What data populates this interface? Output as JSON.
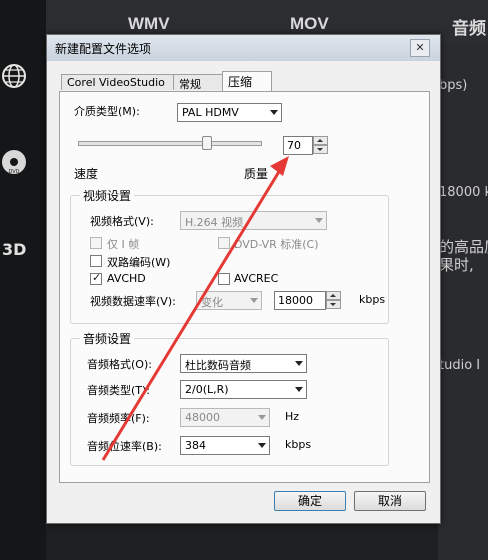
{
  "background": {
    "tabs": [
      "WMV",
      "MOV",
      "音频"
    ],
    "right_texts": [
      "bps)",
      "18000 k",
      "的高品质",
      "果时,",
      "tudio I"
    ]
  },
  "dialog": {
    "title": "新建配置文件选项",
    "close_symbol": "✕",
    "tabs": [
      "Corel VideoStudio",
      "常规",
      "压缩"
    ],
    "active_tab": "压缩",
    "media_type_label": "介质类型(M):",
    "media_type_value": "PAL HDMV",
    "quality_value": "70",
    "speed_label": "速度",
    "quality_label": "质量",
    "video": {
      "group_title": "视频设置",
      "format_label": "视频格式(V):",
      "format_value": "H.264 视频",
      "iframe_only_label": "仅 I 帧",
      "dvdvr_label": "DVD-VR 标准(C)",
      "dual_pass_label": "双路编码(W)",
      "avchd_label": "AVCHD",
      "avcrec_label": "AVCREC",
      "bitrate_label": "视频数据速率(V):",
      "bitrate_mode": "变化",
      "bitrate_value": "18000",
      "bitrate_unit": "kbps"
    },
    "audio": {
      "group_title": "音频设置",
      "format_label": "音频格式(O):",
      "format_value": "杜比数码音频",
      "type_label": "音频类型(T):",
      "type_value": "2/0(L,R)",
      "freq_label": "音频频率(F):",
      "freq_value": "48000",
      "freq_unit": "Hz",
      "bitrate_label": "音频位速率(B):",
      "bitrate_value": "384",
      "bitrate_unit": "kbps"
    },
    "ok_label": "确定",
    "cancel_label": "取消"
  },
  "annotation_color": "#e53935"
}
